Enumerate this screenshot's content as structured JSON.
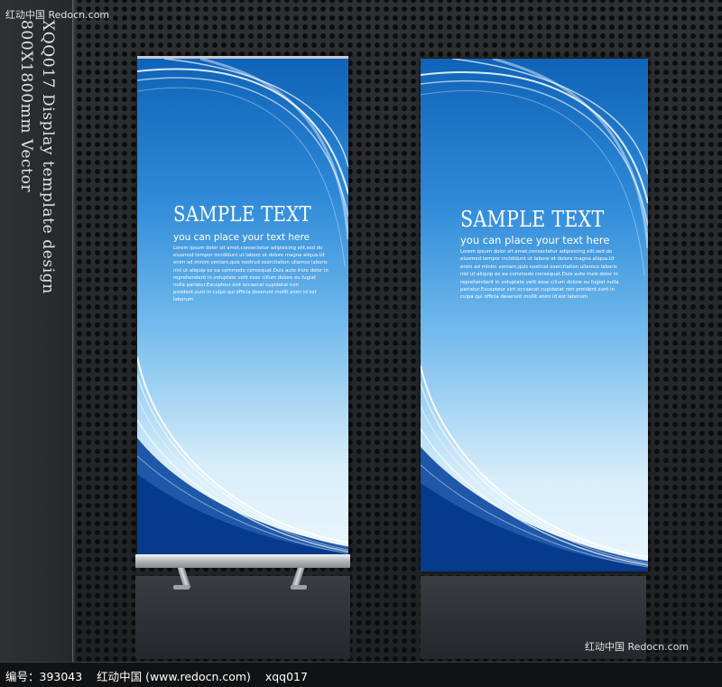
{
  "watermark_top": "红动中国 Redocn.com",
  "watermark_bottom_right": "红动中国 Redocn.com",
  "side_caption": {
    "line1": "XQQ017 Display template design",
    "line2": "800X1800mm Vector"
  },
  "banners": [
    {
      "title": "SAMPLE TEXT",
      "subtitle": "you can place your text here",
      "body": "Lorem ipsum dolor sit amet,consectetur adipisicing elit,sed do eiusmod tempor incididunt ut labore et dolore magna aliqua.Ut enim ad minim veniam,quis nostrud exercitation ullamco laboris nisi ut aliquip ex ea commodo consequat.Duis aute irure dolor in reprehenderit in voluptate velit esse cillum dolore eu fugiat nulla pariatur.Excepteur sint occaecat cupidatat non proident,sunt in culpa qui officia deserunt mollit anim id est laborum"
    },
    {
      "title": "SAMPLE TEXT",
      "subtitle": "you can place your text here",
      "body": "Lorem ipsum dolor sit amet,consectetur adipisicing elit,sed do eiusmod tempor incididunt ut labore et dolore magna aliqua.Ut enim ad minim veniam,quis nostrud exercitation ullamco laboris nisi ut aliquip ex ea commodo consequat.Duis aute irure dolor in reprehenderit in voluptate velit esse cillum dolore eu fugiat nulla pariatur.Excepteur sint occaecat cupidatat non proident,sunt in culpa qui officia deserunt mollit anim id est laborum"
    }
  ],
  "footer": {
    "text": "编号：393043    红动中国 (www.redocn.com)    xqq017"
  },
  "colors": {
    "banner_blue_dark": "#0f63b8",
    "banner_blue_light": "#6eb8ec",
    "background_dark": "#232527"
  }
}
